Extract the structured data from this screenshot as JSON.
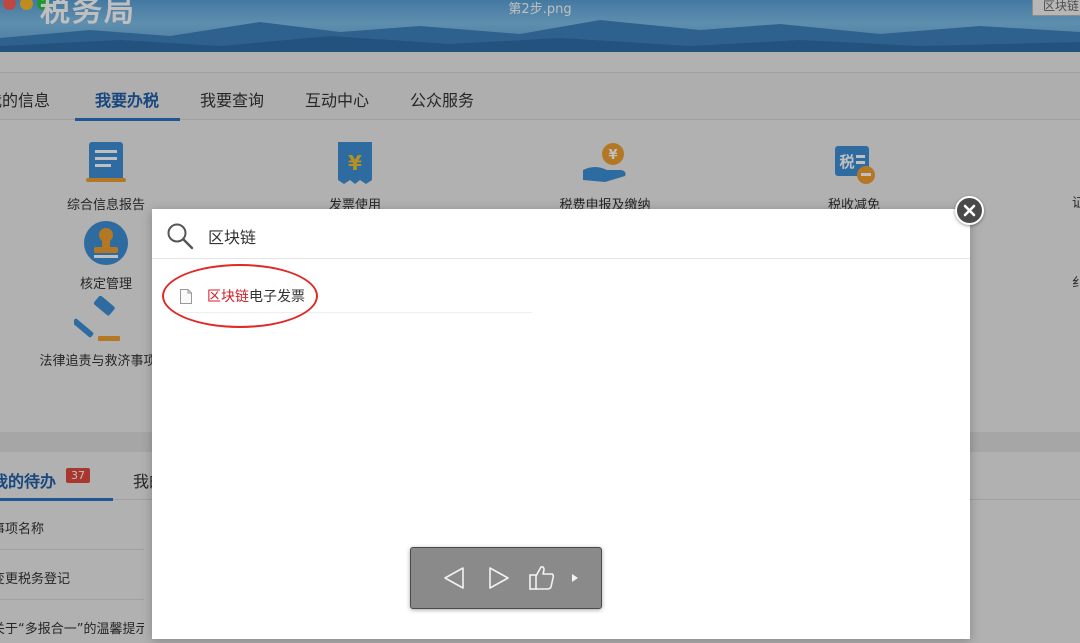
{
  "window": {
    "title": "第2步.png",
    "brand": "税务局",
    "top_search_text": "区块链"
  },
  "nav": {
    "items": [
      {
        "label": "我的信息",
        "active": false
      },
      {
        "label": "我要办税",
        "active": true
      },
      {
        "label": "我要查询",
        "active": false
      },
      {
        "label": "互动中心",
        "active": false
      },
      {
        "label": "公众服务",
        "active": false
      }
    ]
  },
  "services": [
    {
      "label": "综合信息报告",
      "icon": "document-list-icon"
    },
    {
      "label": "发票使用",
      "icon": "yuan-invoice-icon"
    },
    {
      "label": "税费申报及缴纳",
      "icon": "hand-coin-icon"
    },
    {
      "label": "税收减免",
      "icon": "tax-minus-icon"
    },
    {
      "label": "核定管理",
      "icon": "stamp-icon"
    },
    {
      "label": "法律追责与救济事项",
      "icon": "gavel-icon"
    }
  ],
  "todo": {
    "title": "我的待办",
    "badge": "37",
    "second_tab": "我的",
    "rows": [
      "事项名称",
      "变更税务登记",
      "关于“多报合一”的温馨提示"
    ]
  },
  "modal": {
    "query": "区块链",
    "result": {
      "highlight": "区块链",
      "rest": "电子发票"
    }
  },
  "colors": {
    "accent": "#1f5fa8",
    "highlight": "#d0202a",
    "badge": "#e04b3f",
    "annotation_circle": "#e02a25"
  }
}
